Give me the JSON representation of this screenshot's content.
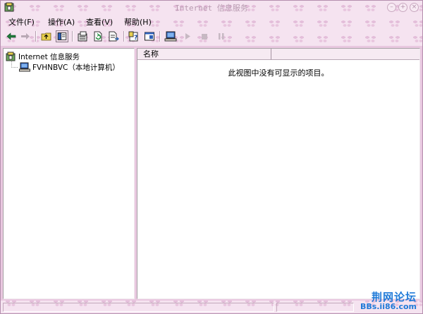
{
  "window": {
    "title": "Internet 信息服务",
    "icon": "iis-app-icon",
    "controls": [
      "minimize-icon",
      "maximize-icon",
      "close-icon"
    ]
  },
  "menubar": {
    "items": [
      {
        "label": "文件(F)"
      },
      {
        "label": "操作(A)"
      },
      {
        "label": "查看(V)"
      },
      {
        "label": "帮助(H)"
      }
    ]
  },
  "toolbar": {
    "buttons": [
      "back-icon",
      "forward-icon",
      "up-folder-icon",
      "show-tree-icon",
      "properties-icon",
      "refresh-icon",
      "export-list-icon",
      "help-icon",
      "console-icon",
      "computer-icon",
      "start-icon",
      "stop-icon",
      "pause-icon"
    ]
  },
  "tree": {
    "root_label": "Internet 信息服务",
    "child_label": "FVHNBVC（本地计算机）"
  },
  "list": {
    "column_name": "名称",
    "empty_message": "此视图中没有可显示的项目。"
  },
  "watermark": {
    "main": "荆网论坛",
    "sub": "BBs.ii86.com"
  },
  "colors": {
    "window_bg": "#f4e2ef",
    "pattern": "#d6a0c8",
    "watermark": "#1f7ad8"
  }
}
